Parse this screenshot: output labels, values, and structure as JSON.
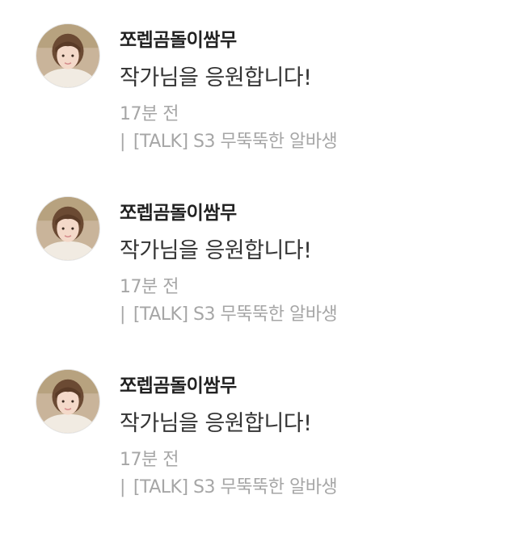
{
  "comments": [
    {
      "avatar_icon": "user-avatar-photo",
      "nickname": "쪼렙곰돌이쌈무",
      "text": "작가님을 응원합니다!",
      "time": "17분 전",
      "episode_separator": "|",
      "episode": "[TALK] S3 무뚝뚝한 알바생"
    },
    {
      "avatar_icon": "user-avatar-photo",
      "nickname": "쪼렙곰돌이쌈무",
      "text": "작가님을 응원합니다!",
      "time": "17분 전",
      "episode_separator": "|",
      "episode": "[TALK] S3 무뚝뚝한 알바생"
    },
    {
      "avatar_icon": "user-avatar-photo",
      "nickname": "쪼렙곰돌이쌈무",
      "text": "작가님을 응원합니다!",
      "time": "17분 전",
      "episode_separator": "|",
      "episode": "[TALK] S3 무뚝뚝한 알바생"
    }
  ],
  "colors": {
    "nickname": "#222222",
    "text": "#333333",
    "meta": "#a6a6a6"
  }
}
